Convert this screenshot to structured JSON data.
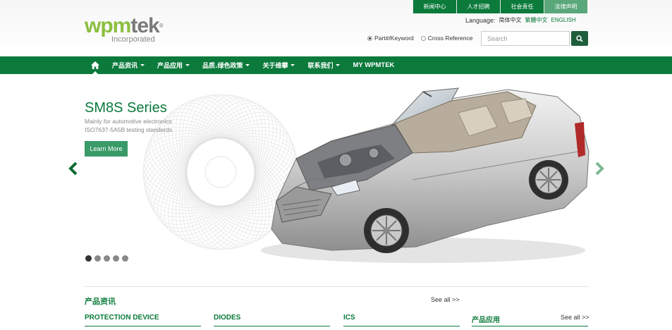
{
  "top_links": [
    "新闻中心",
    "人才招聘",
    "社会责任",
    "法律声明"
  ],
  "brand": {
    "logo_text_wp": "wpm",
    "logo_text_mtek": "tek",
    "logo_sub": "Incorporated",
    "registered": "®"
  },
  "language": {
    "label": "Language:",
    "simplified": "简体中文",
    "traditional": "繁體中文",
    "english": "ENGLISH"
  },
  "search": {
    "option_part": "Part#/Keyword",
    "option_cross": "Cross Reference",
    "selected": "Part#/Keyword",
    "placeholder": "Search"
  },
  "nav": {
    "items": [
      "产品资讯",
      "产品应用",
      "品质.绿色政策",
      "关于维攀",
      "联系我们",
      "MY WPMTEK"
    ]
  },
  "hero": {
    "title": "SM8S Series",
    "sub1": "Mainly for automotive electronics",
    "sub2": "ISO7637-5A5B testing standards",
    "button": "Learn More",
    "slide_count": 5,
    "active_slide": 1
  },
  "sections": {
    "products_title": "产品资讯",
    "see_all": "See all >>",
    "categories": [
      "PROTECTION DEVICE",
      "DIODES",
      "ICS"
    ],
    "app_title": "产品应用",
    "app_see_all": "See all >>"
  },
  "colors": {
    "brand_green": "#0b7a3b",
    "light_green": "#3a9a68",
    "logo_green": "#8bbf3f"
  }
}
